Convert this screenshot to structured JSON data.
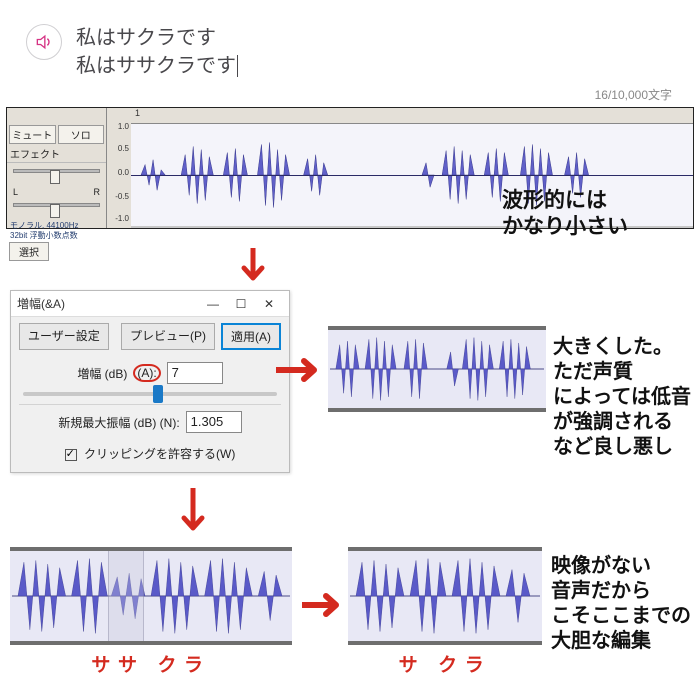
{
  "tts": {
    "line1": "私はサクラです",
    "line2": "私はササクラです"
  },
  "char_count": "16/10,000文字",
  "track_panel": {
    "mute": "ミュート",
    "solo": "ソロ",
    "effects": "エフェクト",
    "pan_left": "L",
    "pan_right": "R",
    "info1": "モノラル, 44100Hz",
    "info2": "32bit 浮動小数点数",
    "select": "選択",
    "time_marker": "1",
    "scale": {
      "p10": "1.0",
      "p05": "0.5",
      "z": "0.0",
      "m05": "-0.5",
      "m10": "-1.0"
    }
  },
  "dialog": {
    "title": "増幅(&A)",
    "user_settings": "ユーザー設定",
    "preview": "プレビュー(P)",
    "apply": "適用(A)",
    "gain_label": "増幅 (dB)",
    "gain_suffix": "(A):",
    "gain_value": "7",
    "new_peak_label": "新規最大振幅 (dB) (N):",
    "new_peak_value": "1.305",
    "allow_clipping": "クリッピングを許容する(W)"
  },
  "annotations": {
    "a1": "波形的には\nかなり小さい",
    "a2": "大きくした。\nただ声質\nによっては低音\nが強調される\nなど良し悪し",
    "a3": "映像がない\n音声だから\nこそここまでの\n大胆な編集"
  },
  "labels": {
    "sasakura": "ササ クラ",
    "sakura": "サ クラ"
  },
  "colors": {
    "arrow": "#d42a1f",
    "wave": "#5050b8",
    "wave_fill": "#6a6ad0"
  }
}
